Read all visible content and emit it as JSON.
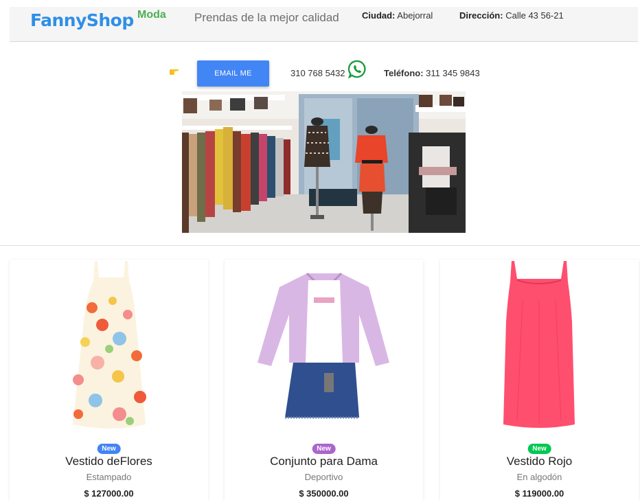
{
  "header": {
    "brand": "FannyShop",
    "tag": "Moda",
    "slogan": "Prendas de la mejor calidad",
    "city_label": "Ciudad:",
    "city_value": "Abejorral",
    "address_label": "Dirección:",
    "address_value": "Calle 43 56-21"
  },
  "contact": {
    "email_button": "EMAIL ME",
    "whatsapp_number": "310 768 5432",
    "phone_label": "Teléfono:",
    "phone_value": "311 345 9843",
    "icons": [
      "pointing-hand-icon",
      "whatsapp-icon"
    ]
  },
  "products": [
    {
      "badge": "New",
      "badge_color": "#4285f4",
      "title": "Vestido deFlores",
      "subtitle": "Estampado",
      "price": "$ 127000.00"
    },
    {
      "badge": "New",
      "badge_color": "#aa66cc",
      "title": "Conjunto para Dama",
      "subtitle": "Deportivo",
      "price": "$ 350000.00"
    },
    {
      "badge": "New",
      "badge_color": "#00c851",
      "title": "Vestido Rojo",
      "subtitle": "En algodón",
      "price": "$ 119000.00"
    }
  ],
  "colors": {
    "brand": "#2f8fe6",
    "tag": "#4caf50",
    "email_button": "#4285f4",
    "whatsapp": "#25a244"
  }
}
